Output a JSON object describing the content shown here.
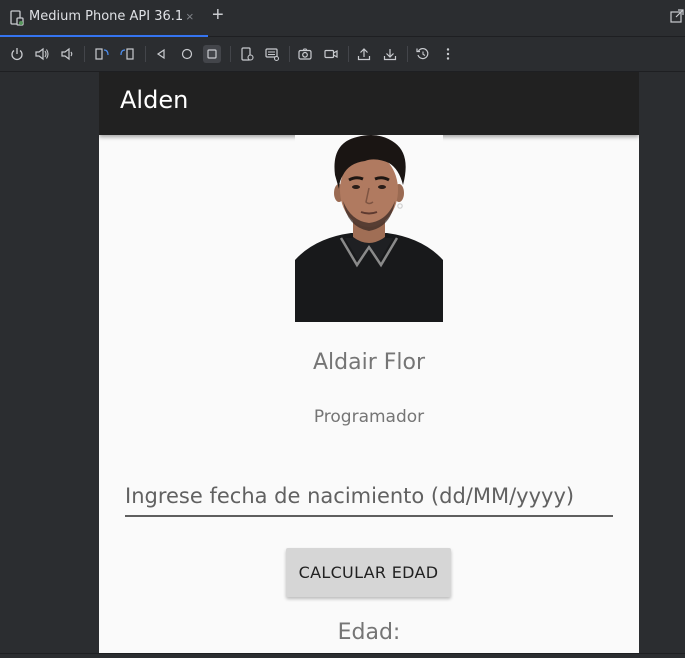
{
  "window": {
    "tab_title": "Medium Phone API 36.1",
    "tab_close": "×",
    "tab_add": "+"
  },
  "toolbar": {
    "buttons": [
      "power-icon",
      "volume-up-icon",
      "volume-down-icon",
      "rotate-left-icon",
      "rotate-right-icon",
      "back-icon",
      "home-icon",
      "overview-icon",
      "fold-icon",
      "keyboard-icon",
      "screenshot-icon",
      "record-icon",
      "upload-icon",
      "download-icon",
      "snapshot-icon",
      "more-icon"
    ]
  },
  "app": {
    "title": "Alden",
    "profile_name": "Aldair Flor",
    "profile_role": "Programador",
    "date_placeholder": "Ingrese fecha de nacimiento (dd/MM/yyyy)",
    "date_value": "",
    "calculate_label": "CALCULAR EDAD",
    "age_label": "Edad:"
  },
  "colors": {
    "ide_bg": "#2b2d30",
    "appbar": "#212121",
    "screen_bg": "#fafafa",
    "button_bg": "#d6d6d6",
    "text_secondary": "#757575"
  }
}
